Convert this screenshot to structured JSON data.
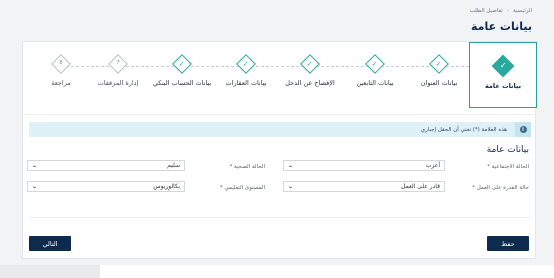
{
  "breadcrumb": {
    "home": "الرئيسية",
    "separator": "›",
    "current": "تفاصيل الطلب"
  },
  "page_title": "بيانات عامة",
  "steps": [
    {
      "label": "بيانات عامة",
      "icon": "✓",
      "icon_name": "check-icon",
      "state": "active"
    },
    {
      "label": "بيانات العنوان",
      "icon": "✓",
      "icon_name": "check-icon",
      "state": "done"
    },
    {
      "label": "بيانات التابعين",
      "icon": "✓",
      "icon_name": "check-icon",
      "state": "done"
    },
    {
      "label": "الإفصاح عن الدخل",
      "icon": "✓",
      "icon_name": "check-icon",
      "state": "done"
    },
    {
      "label": "بيانات العقارات",
      "icon": "✓",
      "icon_name": "check-icon",
      "state": "done"
    },
    {
      "label": "بيانات الحساب البنكي",
      "icon": "✓",
      "icon_name": "check-icon",
      "state": "done"
    },
    {
      "label": "إدارة المرفقات",
      "icon": "7",
      "icon_name": "step-number",
      "state": "pending"
    },
    {
      "label": "مراجعة",
      "icon": "8",
      "icon_name": "step-number",
      "state": "pending"
    }
  ],
  "notice": {
    "icon": "i",
    "text": "هذه العلامة (*) تعني أن الحقل إجباري"
  },
  "section_title": "بيانات عامة",
  "fields": {
    "marital_status": {
      "label": "الحالة الاجتماعية *",
      "value": "أعزب"
    },
    "health_status": {
      "label": "الحالة الصحية *",
      "value": "سليم"
    },
    "work_ability": {
      "label": "حالة القدرة على العمل *",
      "value": "قادر على العمل"
    },
    "education": {
      "label": "المستوى التعليمي *",
      "value": "بكالوريوس"
    }
  },
  "buttons": {
    "save": "حفظ",
    "next": "التالي"
  },
  "colors": {
    "primary": "#0d2b4f",
    "accent": "#29a99d",
    "notice_bg": "#dff1f8"
  }
}
